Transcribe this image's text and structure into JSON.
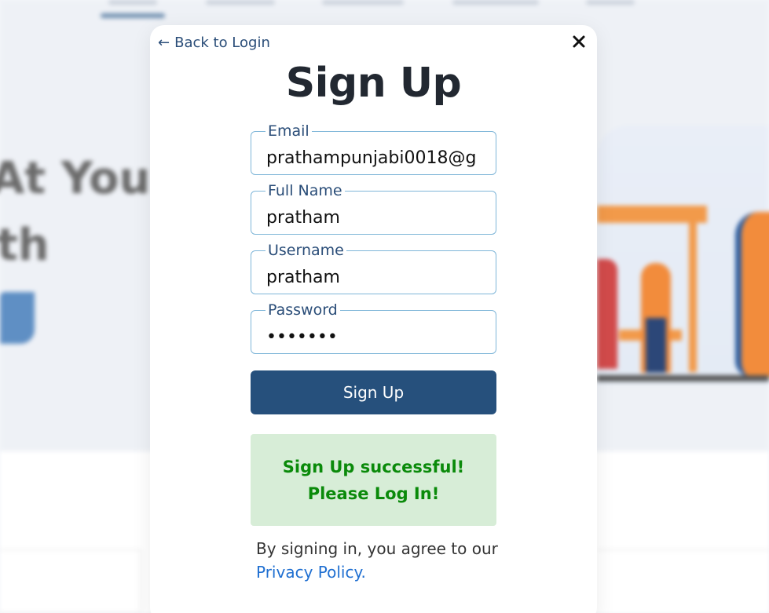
{
  "background": {
    "headline_line1": "At Your",
    "headline_line2": "th"
  },
  "modal": {
    "back_label": "Back to Login",
    "back_icon": "arrow-left-icon",
    "close_icon": "close-icon",
    "title": "Sign Up",
    "fields": [
      {
        "label": "Email",
        "value": "prathampunjabi0018@g",
        "type": "text"
      },
      {
        "label": "Full Name",
        "value": "pratham",
        "type": "text"
      },
      {
        "label": "Username",
        "value": "pratham",
        "type": "text"
      },
      {
        "label": "Password",
        "value": "•••••••",
        "type": "text"
      }
    ],
    "submit_label": "Sign Up",
    "success_line1": "Sign Up successful!",
    "success_line2": "Please Log In!",
    "agree_text": "By signing in, you agree to our",
    "privacy_link": "Privacy Policy."
  },
  "colors": {
    "primary": "#26507c",
    "success_bg": "#d7edd7",
    "success_text": "#0a8a0a",
    "link": "#1f6fd1",
    "field_border": "#7fb6d8"
  }
}
